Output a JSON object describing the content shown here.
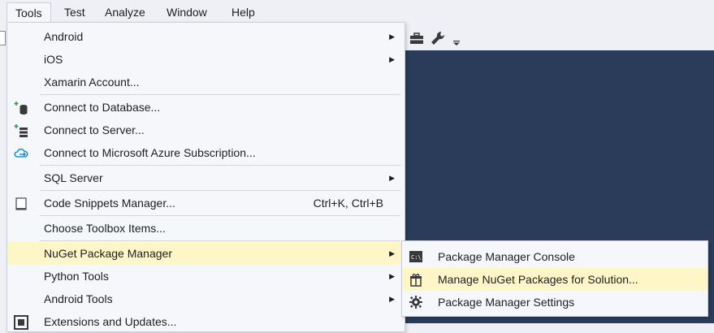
{
  "menubar": {
    "items": [
      {
        "label": "Tools",
        "active": true
      },
      {
        "label": "Test"
      },
      {
        "label": "Analyze"
      },
      {
        "label": "Window"
      },
      {
        "label": "Help"
      }
    ]
  },
  "toolbar": {
    "icons": [
      "toolbox-icon",
      "wrench-icon",
      "overflow-chevron-icon"
    ]
  },
  "tools_menu": {
    "items": [
      {
        "label": "Android",
        "submenu": true
      },
      {
        "label": "iOS",
        "submenu": true
      },
      {
        "label": "Xamarin Account..."
      },
      {
        "label": "Connect to Database...",
        "icon": "connect-database-icon"
      },
      {
        "label": "Connect to Server...",
        "icon": "connect-server-icon"
      },
      {
        "label": "Connect to Microsoft Azure Subscription...",
        "icon": "azure-cloud-icon"
      },
      {
        "label": "SQL Server",
        "submenu": true
      },
      {
        "label": "Code Snippets Manager...",
        "shortcut": "Ctrl+K, Ctrl+B",
        "icon": "snippets-icon"
      },
      {
        "label": "Choose Toolbox Items..."
      },
      {
        "label": "NuGet Package Manager",
        "submenu": true,
        "highlighted": true
      },
      {
        "label": "Python Tools",
        "submenu": true
      },
      {
        "label": "Android Tools",
        "submenu": true
      },
      {
        "label": "Extensions and Updates...",
        "icon": "extensions-icon"
      }
    ]
  },
  "nuget_submenu": {
    "items": [
      {
        "label": "Package Manager Console",
        "icon": "console-icon"
      },
      {
        "label": "Manage NuGet Packages for Solution...",
        "icon": "package-icon",
        "highlighted": true
      },
      {
        "label": "Package Manager Settings",
        "icon": "gear-icon"
      }
    ]
  },
  "colors": {
    "menu_bg": "#f5f7fb",
    "highlight": "#fff6c8",
    "editor_bg": "#2b3c5a",
    "chrome_bg": "#eef0f5"
  }
}
